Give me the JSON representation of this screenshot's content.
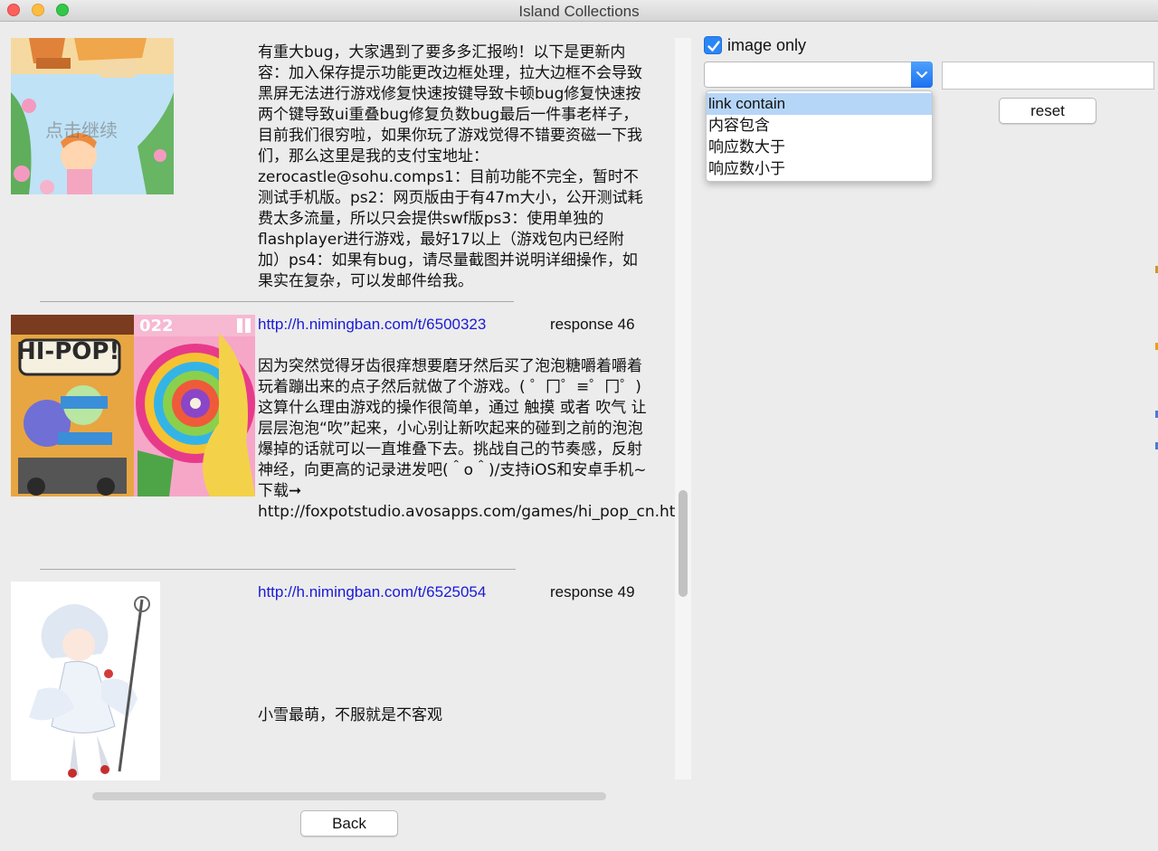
{
  "window": {
    "title": "Island Collections"
  },
  "posts": [
    {
      "text": "有重大bug，大家遇到了要多多汇报哟！以下是更新内容：加入保存提示功能更改边框处理，拉大边框不会导致黑屏无法进行游戏修复快速按键导致卡顿bug修复快速按两个键导致ui重叠bug修复负数bug最后一件事老样子，目前我们很穷啦，如果你玩了游戏觉得不错要资磁一下我们，那么这里是我的支付宝地址：zerocastle@sohu.comps1：目前功能不完全，暂时不测试手机版。ps2：网页版由于有47m大小，公开测试耗费太多流量，所以只会提供swf版ps3：使用单独的flashplayer进行游戏，最好17以上（游戏包内已经附加）ps4：如果有bug，请尽量截图并说明详细操作，如果实在复杂，可以发邮件给我。",
      "thumb_text": "点击继续"
    },
    {
      "link": "http://h.nimingban.com/t/6500323",
      "response": "response 46",
      "text": "因为突然觉得牙齿很痒想要磨牙然后买了泡泡糖嚼着嚼着玩着蹦出来的点子然后就做了个游戏。( ゜冂゜≡゜冂゜)这算什么理由游戏的操作很简单，通过 触摸 或者 吹气 让层层泡泡“吹”起来，小心别让新吹起来的碰到之前的泡泡爆掉的话就可以一直堆叠下去。挑战自己的节奏感，反射神经，向更高的记录进发吧(＾o＾)/支持iOS和安卓手机~下载➞ http://foxpotstudio.avosapps.com/games/hi_pop_cn.html",
      "thumb_text": "HI-POP!",
      "thumb_score": "022"
    },
    {
      "link": "http://h.nimingban.com/t/6525054",
      "response": "response 49",
      "text": "小雪最萌，不服就是不客观"
    }
  ],
  "controls": {
    "back_label": "Back",
    "reset_label": "reset",
    "image_only_label": "image only",
    "image_only_checked": true,
    "combo_value": "",
    "text_value": "",
    "filter_options": [
      "link contain",
      "内容包含",
      "响应数大于",
      "响应数小于"
    ],
    "filter_selected": "link contain"
  },
  "colors": {
    "link": "#1a1ad6",
    "accent": "#2b86f5",
    "selection": "#b6d6f8"
  }
}
